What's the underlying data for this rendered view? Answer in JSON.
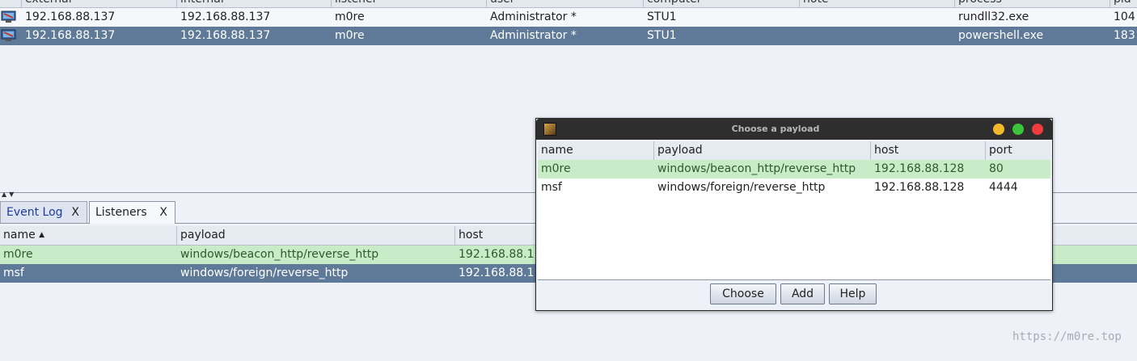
{
  "beacons": {
    "columns": [
      "external",
      "internal",
      "listener",
      "user",
      "computer",
      "note",
      "process",
      "pid"
    ],
    "rows": [
      {
        "external": "192.168.88.137",
        "internal": "192.168.88.137",
        "listener": "m0re",
        "user": "Administrator *",
        "computer": "STU1",
        "note": "",
        "process": "rundll32.exe",
        "pid": "104"
      },
      {
        "external": "192.168.88.137",
        "internal": "192.168.88.137",
        "listener": "m0re",
        "user": "Administrator *",
        "computer": "STU1",
        "note": "",
        "process": "powershell.exe",
        "pid": "183"
      }
    ]
  },
  "tabs": [
    {
      "label": "Event Log",
      "close": "X"
    },
    {
      "label": "Listeners",
      "close": "X"
    }
  ],
  "listeners": {
    "columns": {
      "name": "name",
      "sort_indicator": "▲",
      "payload": "payload",
      "host": "host"
    },
    "rows": [
      {
        "name": "m0re",
        "payload": "windows/beacon_http/reverse_http",
        "host": "192.168.88.1"
      },
      {
        "name": "msf",
        "payload": "windows/foreign/reverse_http",
        "host": "192.168.88.1"
      }
    ]
  },
  "dialog": {
    "title": "Choose a payload",
    "columns": {
      "name": "name",
      "payload": "payload",
      "host": "host",
      "port": "port"
    },
    "rows": [
      {
        "name": "m0re",
        "payload": "windows/beacon_http/reverse_http",
        "host": "192.168.88.128",
        "port": "80"
      },
      {
        "name": "msf",
        "payload": "windows/foreign/reverse_http",
        "host": "192.168.88.128",
        "port": "4444"
      }
    ],
    "buttons": {
      "choose": "Choose",
      "add": "Add",
      "help": "Help"
    },
    "window_colors": {
      "minimize": "#f5b829",
      "maximize": "#3cc43c",
      "close": "#f03c3c"
    }
  },
  "watermark": "https://m0re.top",
  "colors": {
    "selected_row": "#5f7a99",
    "listener_row": "#c8ecc8"
  }
}
